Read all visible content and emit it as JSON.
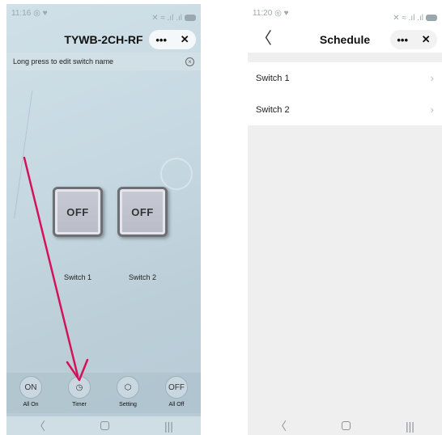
{
  "left": {
    "status": {
      "time": "11:16",
      "left_icons": "◎ ♥",
      "right_icons": "✕ ≈ .ıl .ıl"
    },
    "title": "TYWB-2CH-RF",
    "menu_dots": "•••",
    "close": "✕",
    "hint": "Long press to edit switch name",
    "hint_close": "×",
    "switches": [
      {
        "state": "OFF",
        "label": "Switch 1"
      },
      {
        "state": "OFF",
        "label": "Switch 2"
      }
    ],
    "toolbar": [
      {
        "icon": "ON",
        "label": "All On"
      },
      {
        "icon": "◷",
        "label": "Timer"
      },
      {
        "icon": "⬡",
        "label": "Setting"
      },
      {
        "icon": "OFF",
        "label": "All Off"
      }
    ]
  },
  "right": {
    "status": {
      "time": "11:20",
      "left_icons": "◎ ♥",
      "right_icons": "✕ ≈ .ıl .ıl"
    },
    "back": "〈",
    "title": "Schedule",
    "menu_dots": "•••",
    "close": "✕",
    "items": [
      {
        "label": "Switch 1",
        "chevron": "›"
      },
      {
        "label": "Switch 2",
        "chevron": "›"
      }
    ]
  },
  "nav": {
    "back": "〈",
    "recents": "|||"
  },
  "colors": {
    "arrow": "#d3125a",
    "switch_face": "#c2c4ce",
    "toolbar_bg": "#b3c6d0"
  }
}
